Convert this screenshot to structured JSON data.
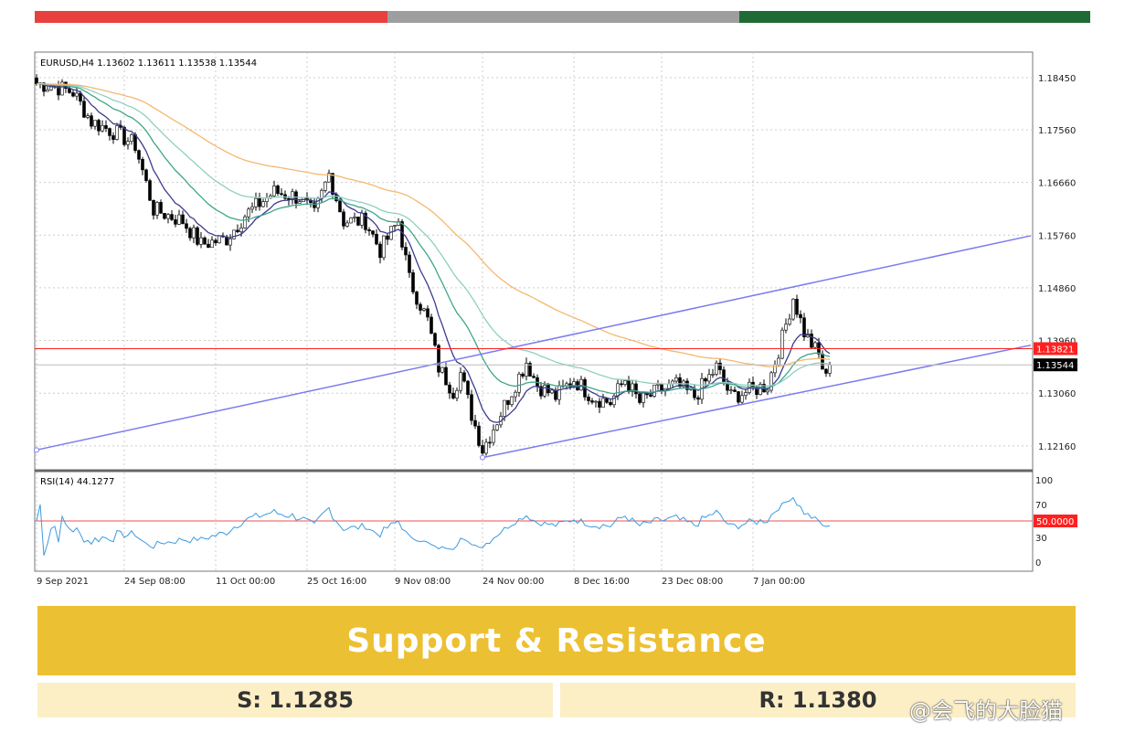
{
  "top_bar_colors": [
    "#e8403c",
    "#9e9e9e",
    "#1f6b35"
  ],
  "chart_data": {
    "type": "candlestick",
    "title": "EURUSD,H4  1.13602 1.13611 1.13538 1.13544",
    "ylim": [
      1.1185,
      1.189
    ],
    "y_ticks": [
      "1.18450",
      "1.17560",
      "1.16660",
      "1.15760",
      "1.14860",
      "1.13960",
      "1.13060",
      "1.12160"
    ],
    "x_ticks": [
      {
        "bar": 0,
        "label": "9 Sep 2021"
      },
      {
        "bar": 24,
        "label": "24 Sep 08:00"
      },
      {
        "bar": 49,
        "label": "11 Oct 00:00"
      },
      {
        "bar": 74,
        "label": "25 Oct 16:00"
      },
      {
        "bar": 98,
        "label": "9 Nov 08:00"
      },
      {
        "bar": 122,
        "label": "24 Nov 00:00"
      },
      {
        "bar": 147,
        "label": "8 Dec 16:00"
      },
      {
        "bar": 171,
        "label": "23 Dec 08:00"
      },
      {
        "bar": 196,
        "label": "7 Jan 00:00"
      }
    ],
    "close_keypoints": [
      [
        0,
        1.1835
      ],
      [
        5,
        1.183
      ],
      [
        10,
        1.182
      ],
      [
        15,
        1.177
      ],
      [
        22,
        1.175
      ],
      [
        27,
        1.173
      ],
      [
        32,
        1.162
      ],
      [
        40,
        1.16
      ],
      [
        45,
        1.156
      ],
      [
        52,
        1.157
      ],
      [
        57,
        1.161
      ],
      [
        65,
        1.165
      ],
      [
        72,
        1.164
      ],
      [
        76,
        1.161
      ],
      [
        80,
        1.168
      ],
      [
        84,
        1.16
      ],
      [
        90,
        1.16
      ],
      [
        94,
        1.155
      ],
      [
        99,
        1.16
      ],
      [
        102,
        1.15
      ],
      [
        107,
        1.143
      ],
      [
        110,
        1.135
      ],
      [
        114,
        1.131
      ],
      [
        116,
        1.134
      ],
      [
        119,
        1.127
      ],
      [
        122,
        1.121
      ],
      [
        126,
        1.126
      ],
      [
        130,
        1.131
      ],
      [
        134,
        1.136
      ],
      [
        137,
        1.132
      ],
      [
        142,
        1.13
      ],
      [
        147,
        1.133
      ],
      [
        152,
        1.13
      ],
      [
        157,
        1.129
      ],
      [
        161,
        1.133
      ],
      [
        165,
        1.129
      ],
      [
        170,
        1.131
      ],
      [
        175,
        1.132
      ],
      [
        180,
        1.13
      ],
      [
        186,
        1.135
      ],
      [
        190,
        1.13
      ],
      [
        195,
        1.131
      ],
      [
        200,
        1.132
      ],
      [
        204,
        1.14
      ],
      [
        207,
        1.147
      ],
      [
        210,
        1.141
      ],
      [
        214,
        1.137
      ],
      [
        216,
        1.133
      ],
      [
        217,
        1.13544
      ]
    ],
    "moving_average_colors": [
      "#3b3b8f",
      "#3fa58a",
      "#8fd0c0",
      "#f4b870"
    ],
    "last_price": "1.13544",
    "resistance_line": {
      "price": 1.13821,
      "label": "1.13821",
      "color": "#ff2020"
    },
    "channel_upper": [
      [
        0,
        1.1209
      ],
      [
        272,
        1.1575
      ]
    ],
    "channel_lower": [
      [
        122,
        1.1196
      ],
      [
        272,
        1.1388
      ]
    ],
    "rsi": {
      "label": "RSI(14) 44.1277",
      "levels": [
        "100",
        "70",
        "50.0000",
        "30",
        "0"
      ],
      "level_line": 50
    }
  },
  "banner": {
    "title": "Support & Resistance"
  },
  "support": "S: 1.1285",
  "resistance": "R: 1.1380",
  "watermark": "@会飞的大脸猫"
}
